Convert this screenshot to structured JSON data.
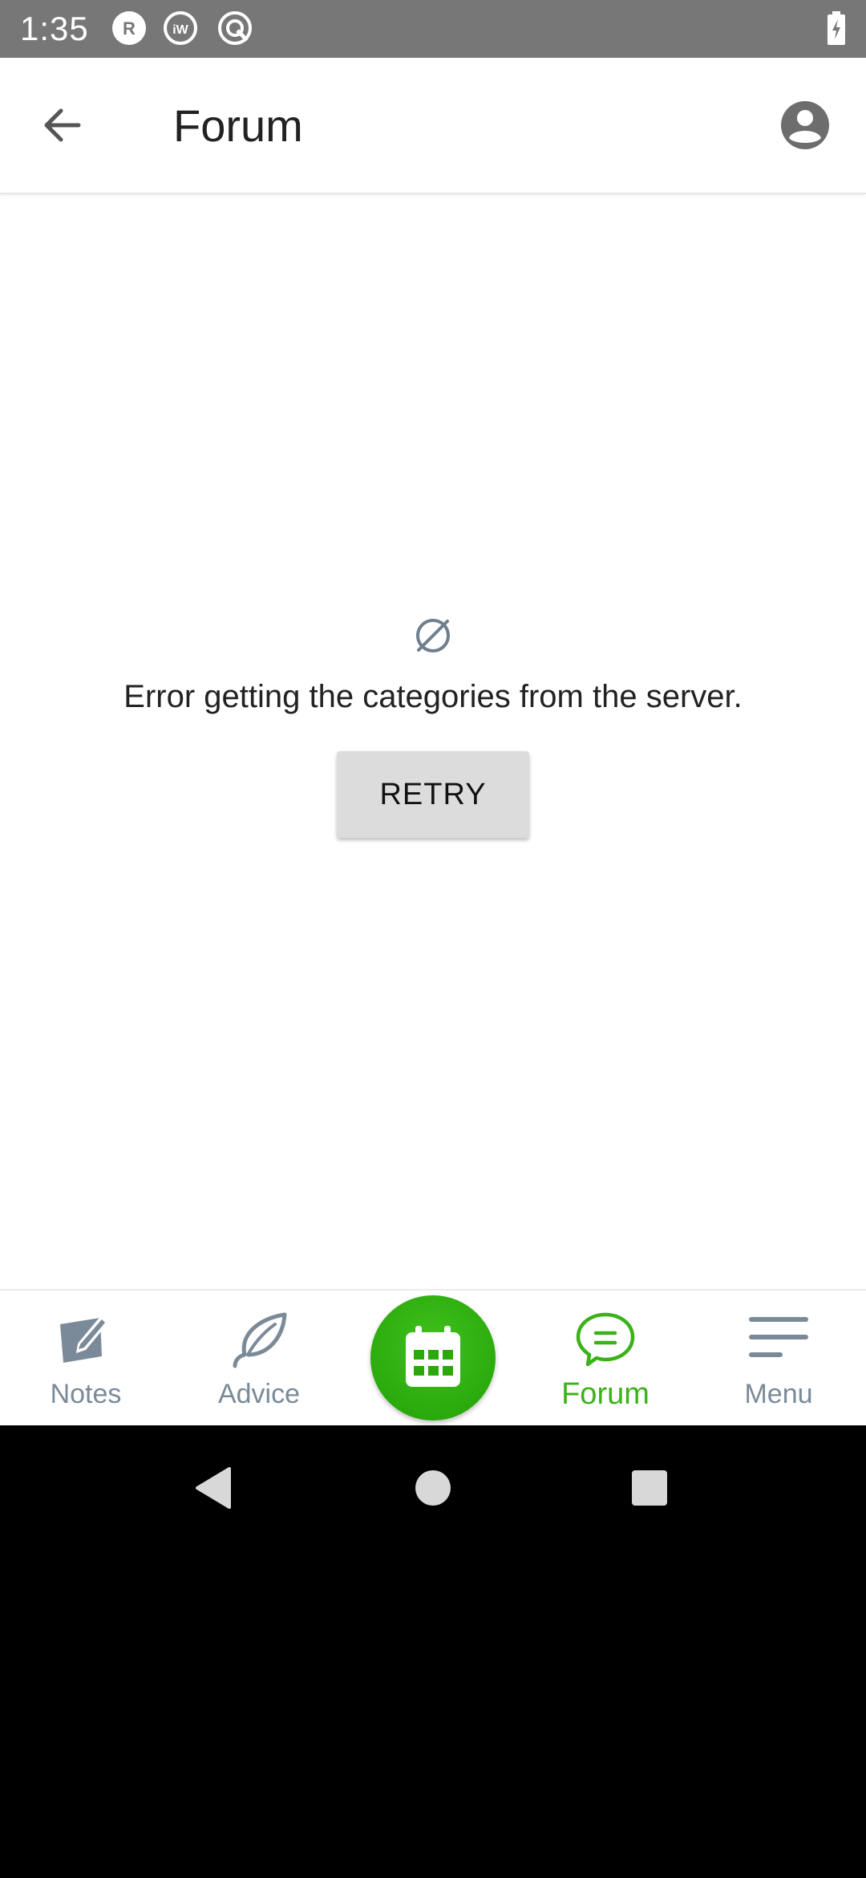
{
  "status_bar": {
    "time": "1:35",
    "icons": [
      "r-notification-icon",
      "iw-notification-icon",
      "sync-icon",
      "battery-charging-icon"
    ]
  },
  "app_bar": {
    "title": "Forum",
    "back_icon": "back-arrow-icon",
    "account_icon": "account-circle-icon"
  },
  "error": {
    "icon": "empty-set-icon",
    "message": "Error getting the categories from the server.",
    "retry_label": "RETRY"
  },
  "bottom_nav": {
    "items": [
      {
        "label": "Notes",
        "icon": "notes-pencil-icon",
        "active": false
      },
      {
        "label": "Advice",
        "icon": "leaf-icon",
        "active": false
      },
      {
        "label": "Forum",
        "icon": "chat-bubble-icon",
        "active": true
      },
      {
        "label": "Menu",
        "icon": "menu-lines-icon",
        "active": false
      }
    ],
    "fab_icon": "calendar-icon"
  },
  "colors": {
    "accent": "#3cb21a",
    "inactive": "#7b8a98",
    "status_bar": "#777777"
  },
  "system_nav": {
    "icons": [
      "back-triangle-icon",
      "home-circle-icon",
      "recents-square-icon"
    ]
  }
}
